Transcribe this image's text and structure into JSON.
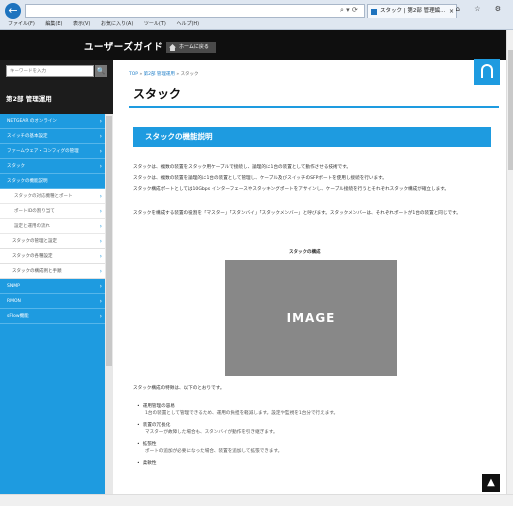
{
  "browser": {
    "back_glyph": "←",
    "tab_title": "スタック | 第2部 管理編...",
    "tab_close": "×",
    "addr_icons": "⌕ ▾ ⟳",
    "window_controls": "⌂ ☆ ⚙",
    "menu": [
      "ファイル(F)",
      "編集(E)",
      "表示(V)",
      "お気に入り(A)",
      "ツール(T)",
      "ヘルプ(H)"
    ]
  },
  "header": {
    "site_title": "ユーザーズガイド",
    "home_button": "ホームに戻る"
  },
  "sidebar": {
    "search_placeholder": "キーワードを入力",
    "search_button_glyph": "🔍",
    "section_title": "第2部 管理運用",
    "items": [
      {
        "label": "NETGEAR のオンライン",
        "type": "top"
      },
      {
        "label": "スイッチの基本設定",
        "type": "top"
      },
      {
        "label": "ファームウェア・コンフィグの管理",
        "type": "top"
      },
      {
        "label": "スタック",
        "type": "top"
      },
      {
        "label": "スタックの機能説明",
        "type": "sub-active"
      },
      {
        "label": "スタックの対応機種とポート",
        "type": "sub2"
      },
      {
        "label": "ポートIDの割り当て",
        "type": "sub2"
      },
      {
        "label": "設定と運用の流れ",
        "type": "sub2"
      },
      {
        "label": "スタックの管理と設定",
        "type": "sub"
      },
      {
        "label": "スタックの各種設定",
        "type": "sub"
      },
      {
        "label": "スタックの構成例と手順",
        "type": "sub"
      },
      {
        "label": "SNMP",
        "type": "top"
      },
      {
        "label": "RMON",
        "type": "top"
      },
      {
        "label": "sFlow機能",
        "type": "top"
      }
    ]
  },
  "main": {
    "breadcrumb_top": "TOP",
    "breadcrumb_sep": " » ",
    "breadcrumb_mid": "第2部 管理運用",
    "breadcrumb_current": "スタック",
    "page_title": "スタック",
    "section_heading": "スタックの機能説明",
    "paragraphs": [
      "スタックは、複数の装置をスタック用ケーブルで接続し、論理的に1台の装置として動作させる技術です。",
      "スタックは、複数の装置を論理的に1台の装置として管理し、ケーブル及びスイッチのSFPポートを使用し接続を行います。",
      "スタック構成ポートとしては10Gbps インターフェースやスタッキングポートをアサインし、ケーブル接続を行うとそれぞれスタック構成が確立します。",
      "スタックを構成する装置の役割を「マスター」「スタンバイ」「スタックメンバー」と呼びます。スタックメンバーは、それぞれポートが1台の装置と同じです。"
    ],
    "figure_caption": "スタックの構成",
    "image_label": "IMAGE",
    "list_intro": "スタック構成の特徴は、以下のとおりです。",
    "bullets": [
      {
        "title": "運用管理の容易",
        "desc": "1台の装置として管理できるため、運用の負担を軽減します。設定や監視を1台分で行えます。"
      },
      {
        "title": "装置の冗長化",
        "desc": "マスターが故障した場合も、スタンバイが動作を引き継ぎます。"
      },
      {
        "title": "拡張性",
        "desc": "ポートの追加が必要になった場合、装置を追加して拡張できます。"
      },
      {
        "title": "柔軟性",
        "desc": ""
      }
    ],
    "to_top_glyph": "▲"
  }
}
